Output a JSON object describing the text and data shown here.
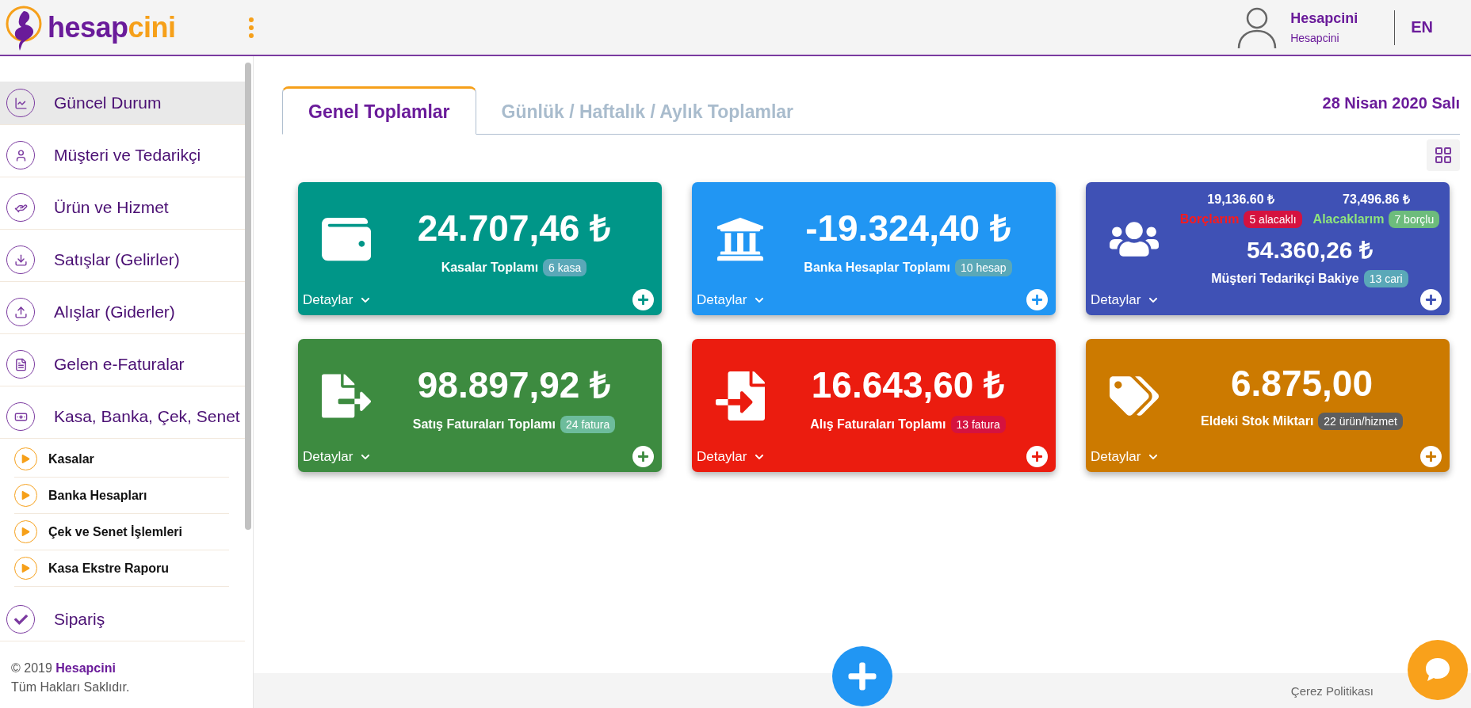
{
  "header": {
    "logo": {
      "part_1": "hesap",
      "part_2": "cini"
    },
    "user": {
      "name": "Hesapcini",
      "company": "Hesapcini"
    },
    "language": "EN"
  },
  "sidebar": {
    "items": [
      {
        "label": "Güncel Durum",
        "selected": true
      },
      {
        "label": "Müşteri ve Tedarikçi",
        "selected": false
      },
      {
        "label": "Ürün ve Hizmet",
        "selected": false
      },
      {
        "label": "Satışlar (Gelirler)",
        "selected": false
      },
      {
        "label": "Alışlar (Giderler)",
        "selected": false
      },
      {
        "label": "Gelen e-Faturalar",
        "selected": false
      },
      {
        "label": "Kasa, Banka, Çek, Senet",
        "selected": false,
        "expanded": true,
        "children": [
          {
            "label": "Kasalar"
          },
          {
            "label": "Banka Hesapları"
          },
          {
            "label": "Çek ve Senet İşlemleri"
          },
          {
            "label": "Kasa Ekstre Raporu"
          }
        ]
      },
      {
        "label": "Sipariş",
        "selected": false
      }
    ],
    "footer": {
      "copyright": "© 2019 **Hesapcini**",
      "rights": "Tüm Hakları Saklıdır."
    }
  },
  "tabs": [
    {
      "label": "Genel Toplamlar",
      "selected": true
    },
    {
      "label": "Günlük / Haftalık / Aylık Toplamlar",
      "selected": false
    }
  ],
  "date": "28 Nisan 2020 Salı",
  "cards": [
    {
      "kind": "simple",
      "color": "#009688",
      "value": "24.707,46 ₺",
      "label": "Kasalar Toplamı",
      "badge": {
        "text": "6 kasa",
        "color": "#5aa8b8"
      },
      "details": "Detaylar"
    },
    {
      "kind": "simple",
      "color": "#2196f3",
      "value": "-19.324,40 ₺",
      "label": "Banka Hesaplar Toplamı",
      "badge": {
        "text": "10 hesap",
        "color": "#5aa8b8"
      },
      "details": "Detaylar"
    },
    {
      "kind": "balance",
      "color": "#3f51b5",
      "debt": {
        "amount": "19,136.60 ₺",
        "label": "Borçlarım",
        "badge": "5 alacaklı"
      },
      "credit": {
        "amount": "73,496.86 ₺",
        "label": "Alacaklarım",
        "badge": "7 borçlu"
      },
      "value": "54.360,26 ₺",
      "label": "Müşteri Tedarikçi Bakiye",
      "badge": {
        "text": "13 cari",
        "color": "#5aa8b8"
      },
      "details": "Detaylar"
    },
    {
      "kind": "simple",
      "color": "#3d8b40",
      "value": "98.897,92 ₺",
      "label": "Satış Faturaları Toplamı",
      "badge": {
        "text": "24 fatura",
        "color": "#6dbc9c"
      },
      "details": "Detaylar"
    },
    {
      "kind": "simple",
      "color": "#eb1c0f",
      "value": "16.643,60 ₺",
      "label": "Alış Faturaları Toplamı",
      "badge": {
        "text": "13 fatura",
        "color": "#d5123f"
      },
      "details": "Detaylar"
    },
    {
      "kind": "simple",
      "color": "#cc7a00",
      "value": "6.875,00",
      "label": "Eldeki Stok Miktarı",
      "badge": {
        "text": "22 ürün/hizmet",
        "color": "#5e5e5e"
      },
      "details": "Detaylar"
    }
  ],
  "footer": {
    "cookie_link": "Çerez Politikası"
  }
}
